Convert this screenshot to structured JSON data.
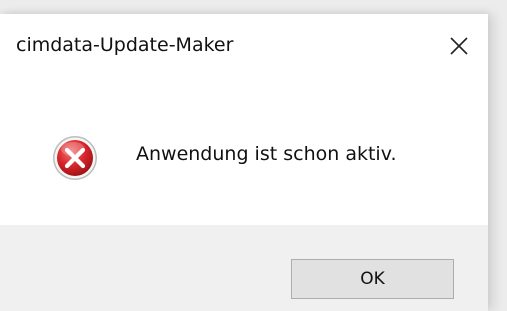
{
  "window": {
    "title": "cimdata-Update-Maker",
    "close_icon": "close-icon"
  },
  "body": {
    "icon": "error-icon",
    "message": "Anwendung ist schon aktiv."
  },
  "footer": {
    "ok_label": "OK"
  },
  "colors": {
    "error_red": "#d9262b",
    "button_bg": "#e1e1e1",
    "button_border": "#adadad",
    "footer_bg": "#f0f0f0"
  }
}
